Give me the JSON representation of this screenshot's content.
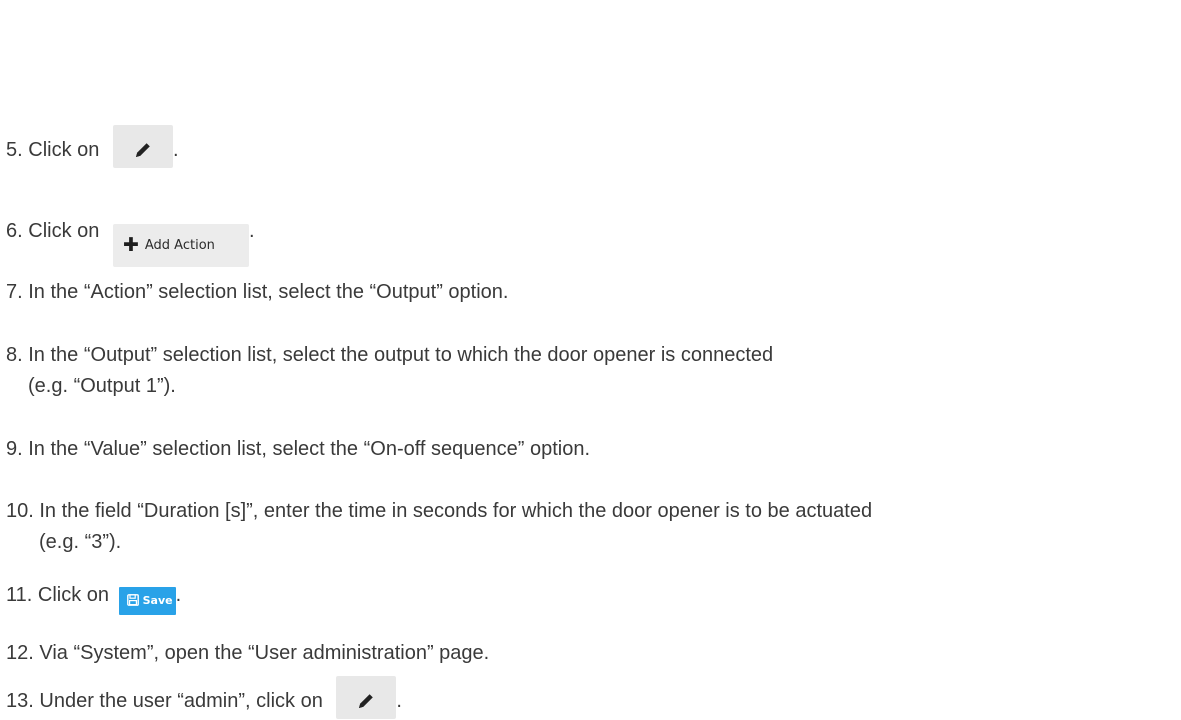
{
  "steps": [
    {
      "number": "5.",
      "prefix": "Click on",
      "suffix": ".",
      "icon": "pencil-icon"
    },
    {
      "number": "6.",
      "prefix": "Click on",
      "suffix": ".",
      "button": {
        "icon": "plus-icon",
        "label": "Add Action"
      }
    },
    {
      "number": "7.",
      "text": "In the “Action” selection list, select the “Output” option."
    },
    {
      "number": "8.",
      "text": "In the “Output” selection list, select the output to which the door opener is connected",
      "continuation": "(e.g. “Output 1”)."
    },
    {
      "number": "9.",
      "text": "In the “Value” selection list, select the “On-off sequence” option."
    },
    {
      "number": "10.",
      "text": "In the field “Duration [s]”, enter the time in seconds for which the door opener is to be actuated",
      "continuation": "(e.g. “3”)."
    },
    {
      "number": "11.",
      "prefix": "Click on",
      "suffix": ".",
      "button": {
        "icon": "floppy-icon",
        "label": "Save",
        "color": "#29a2e8"
      }
    },
    {
      "number": "12.",
      "text": "Via “System”, open the “User administration” page."
    },
    {
      "number": "13.",
      "prefix": "Under the user “admin”, click on",
      "suffix": ".",
      "icon": "pencil-icon"
    }
  ],
  "colors": {
    "text": "#3a3a3a",
    "icon_button_bg": "#e8e8e8",
    "save_button_bg": "#29a2e8"
  }
}
